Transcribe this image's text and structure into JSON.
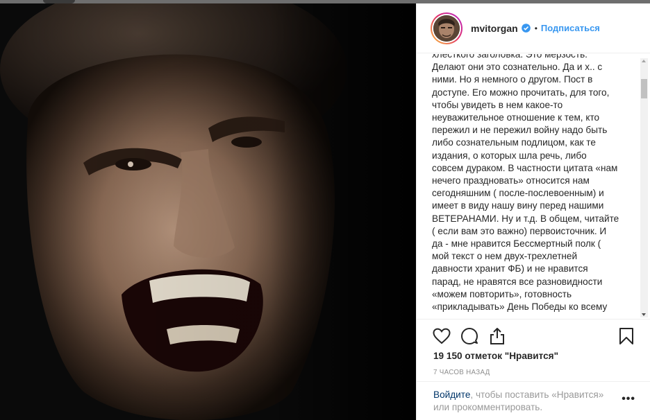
{
  "post": {
    "username": "mvitorgan",
    "verified_icon": "verified-badge-icon",
    "separator": "•",
    "follow_label": "Подписаться",
    "caption": "хлесткого заголовка. Это мерзость.\nДелают они это сознательно. Да и х.. с\nними. Но я немного о другом. Пост в\nдоступе. Его можно прочитать, для того,\nчтобы увидеть в нем какое-то\nнеуважительное отношение к тем, кто\nпережил и не пережил войну надо быть\nлибо сознательным подлицом, как те\nиздания, о которых шла речь, либо\nсовсем дураком. В частности цитата «нам\nнечего праздновать» относится нам\nсегодняшним ( после-послевоенным) и\nимеет в виду нашу вину перед нашими\nВЕТЕРАНАМИ. Ну и т.д. В общем, читайте\n( если вам это важно) первоисточник. И\nда - мне нравится Бессмертный полк (\nмой текст о нем двух-трехлетней\nдавности хранит ФБ) и не нравится\nпарад, не нравятся все разновидности\n«можем повторить», готовность\n«прикладывать» День Победы ко всему",
    "likes_count": "19 150",
    "likes_middle": " отметок ",
    "likes_quote": "\"Нравится\"",
    "time_ago": "7 часов назад",
    "login_link": "Войдите",
    "login_rest": ", чтобы поставить «Нравится» или прокомментировать.",
    "more_label": "•••"
  },
  "icons": {
    "like": "heart-icon",
    "comment": "comment-icon",
    "share": "share-icon",
    "save": "bookmark-icon",
    "more": "more-options-icon"
  },
  "colors": {
    "link_blue": "#3897f0",
    "dark_link": "#003569",
    "text": "#262626",
    "muted": "#8e8e8e"
  }
}
